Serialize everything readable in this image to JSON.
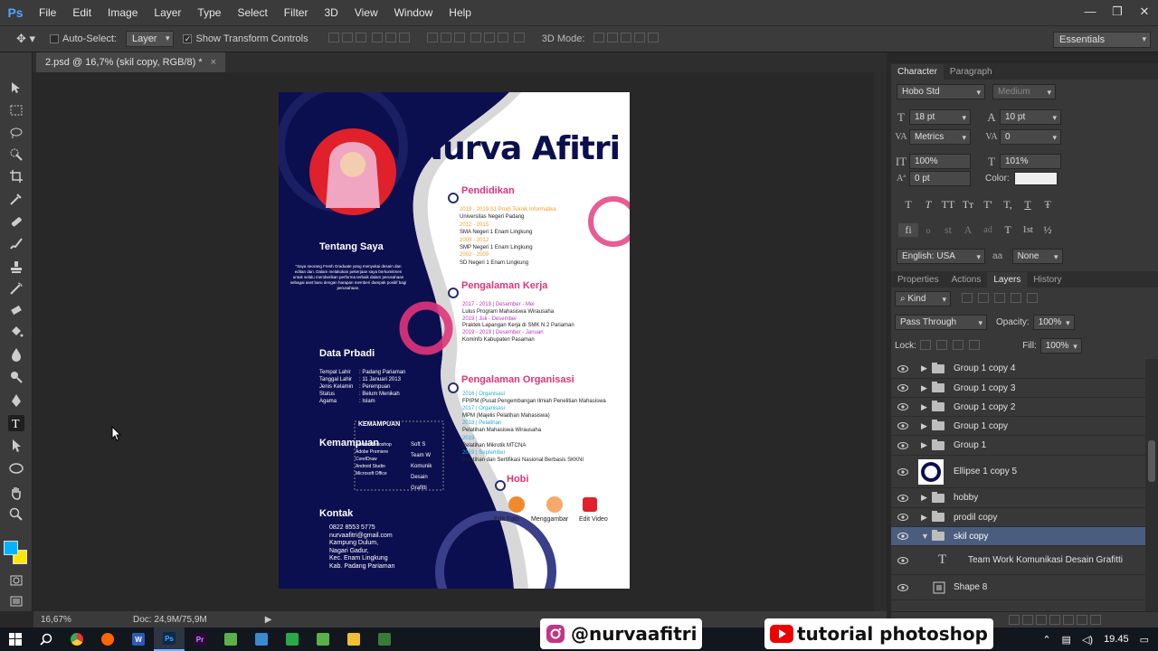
{
  "app": {
    "logo": "Ps"
  },
  "menu": [
    "File",
    "Edit",
    "Image",
    "Layer",
    "Type",
    "Select",
    "Filter",
    "3D",
    "View",
    "Window",
    "Help"
  ],
  "window_controls": [
    "—",
    "❐",
    "✕"
  ],
  "options": {
    "auto_select_label": "Auto-Select:",
    "auto_select_value": "Layer",
    "show_transform_label": "Show Transform Controls",
    "mode_3d_label": "3D Mode:",
    "workspace": "Essentials"
  },
  "document_tab": {
    "title": "2.psd @ 16,7% (skil copy, RGB/8) *",
    "close": "×"
  },
  "status": {
    "zoom": "16,67%",
    "doc_info": "Doc: 24,9M/75,9M"
  },
  "canvas_doc": {
    "name": "Nurva Afitri",
    "about_title": "Tentang Saya",
    "about_text": "\"Saya seorang Fresh Graduate yang menyukai desain dan editan dan. Dalam melakukan pekerjaan saya berkomitmen untuk selalu memberikan performa terbaik dalam perusahaan sebagai aset baru dengan harapan memberi dampak positif bagi perusahaan.",
    "data_title": "Data Prbadi",
    "data_rows": [
      [
        "Tempat Lahir",
        ": Padang Pariaman"
      ],
      [
        "Tanggal Lahir",
        ": 11 Januari 2013"
      ],
      [
        "Jenis Kelamin",
        ": Perempuan"
      ],
      [
        "Status",
        ": Belum Menikah"
      ],
      [
        "Agama",
        ": Islam"
      ]
    ],
    "skills_title": "Kemampuan",
    "skills_box_title": "KEMAMPUAN",
    "hard_skills": [
      "Adobe Photoshop",
      "Adobe Premiere",
      "CorelDraw",
      "Android Studio",
      "Microsoft Office"
    ],
    "soft_skills": [
      "Soft S",
      "Team W",
      "Komunik",
      "Desain",
      "Grafitti"
    ],
    "contact_title": "Kontak",
    "contact_rows": [
      "0822 8553 5775",
      "nurvaafitri@gmail.com",
      "Kampung Dulum,",
      "Nagari Gadur,",
      "Kec. Enam Lingkung",
      "Kab. Padang Pariaman"
    ],
    "edu_title": "Pendidikan",
    "edu_rows": [
      [
        "2019 - 2019 S1 Prodi Teknik Informatika",
        "Universitas Negeri Padang"
      ],
      [
        "2012 - 2015",
        "SMA Negeri 1 Enam Lingkung"
      ],
      [
        "2009 - 2012",
        "SMP Negeri 1 Enam Lingkung"
      ],
      [
        "2002 - 2009",
        "SD Negeri 1 Enam Lingkung"
      ]
    ],
    "work_title": "Pengalaman Kerja",
    "work_rows": [
      [
        "2017 - 2019 | Desember - Mei",
        "Lulus Program Mahasiswa Wirausaha"
      ],
      [
        "2019 | Juli - Desember",
        "Praktek Lapangan Kerja di SMK N 2 Pariaman"
      ],
      [
        "2019 - 2019 | Desember - Januari",
        "Kominfo Kabupaten Pasaman"
      ]
    ],
    "org_title": "Pengalaman Organisasi",
    "org_rows": [
      [
        "2016 | Organisasi",
        "FPIPM (Pusat Pengembangan Ilmiah Penelitian Mahasiswa"
      ],
      [
        "2017 | Organisasi",
        "MPM (Majelis Pelatihan Mahasiswa)"
      ],
      [
        "2018 | Pelatihan",
        "Pelatihan Mahasiswa Wirausaha"
      ],
      [
        "2019",
        "Pelatihan Mikrotik MTCNA"
      ],
      [
        "2019 | September",
        "Pelatihan dan Sertifikasi Nasional Berbasis SKKNI"
      ]
    ],
    "hobby_title": "Hobi",
    "hobbies": [
      "Edit Foto",
      "Menggambar",
      "Edit Video"
    ]
  },
  "character_panel": {
    "tabs": [
      "Character",
      "Paragraph"
    ],
    "font_family": "Hobo Std",
    "font_style": "Medium",
    "font_size": "18 pt",
    "leading": "10 pt",
    "kerning": "Metrics",
    "tracking": "0",
    "vscale": "100%",
    "hscale": "101%",
    "baseline": "0 pt",
    "color_label": "Color:",
    "style_buttons": [
      "T",
      "T",
      "TT",
      "Tт",
      "T'",
      "T,",
      "T",
      "Ŧ"
    ],
    "ot_buttons": [
      "fi",
      "ℴ",
      "st",
      "A",
      "ad",
      "T",
      "1st",
      "½"
    ],
    "language": "English: USA",
    "aa_label": "a",
    "aa_value": "None"
  },
  "layers_panel": {
    "tabs": [
      "Properties",
      "Actions",
      "Layers",
      "History"
    ],
    "filter": "Kind",
    "blend": "Pass Through",
    "opacity_label": "Opacity:",
    "opacity": "100%",
    "lock_label": "Lock:",
    "fill_label": "Fill:",
    "fill": "100%",
    "layers": [
      {
        "name": "Group 1 copy 4",
        "kind": "group"
      },
      {
        "name": "Group 1 copy 3",
        "kind": "group"
      },
      {
        "name": "Group 1 copy 2",
        "kind": "group"
      },
      {
        "name": "Group 1 copy",
        "kind": "group"
      },
      {
        "name": "Group 1",
        "kind": "group"
      },
      {
        "name": "Ellipse 1 copy 5",
        "kind": "shape"
      },
      {
        "name": "hobby",
        "kind": "group"
      },
      {
        "name": "prodil copy",
        "kind": "group"
      },
      {
        "name": "skil copy",
        "kind": "group-open"
      },
      {
        "name": "Team Work Komunikasi Desain Grafitti",
        "kind": "text"
      },
      {
        "name": "Shape 8",
        "kind": "shape"
      }
    ]
  },
  "overlays": {
    "instagram": "@nurvaafitri",
    "youtube": "tutorial photoshop"
  },
  "taskbar": {
    "time": "19.45"
  },
  "colors": {
    "navy": "#0c0f4f",
    "pink": "#e0347a",
    "accent": "#4aa8ff",
    "fg_swatch": "#00b4ff",
    "bg_swatch": "#ffe600"
  }
}
